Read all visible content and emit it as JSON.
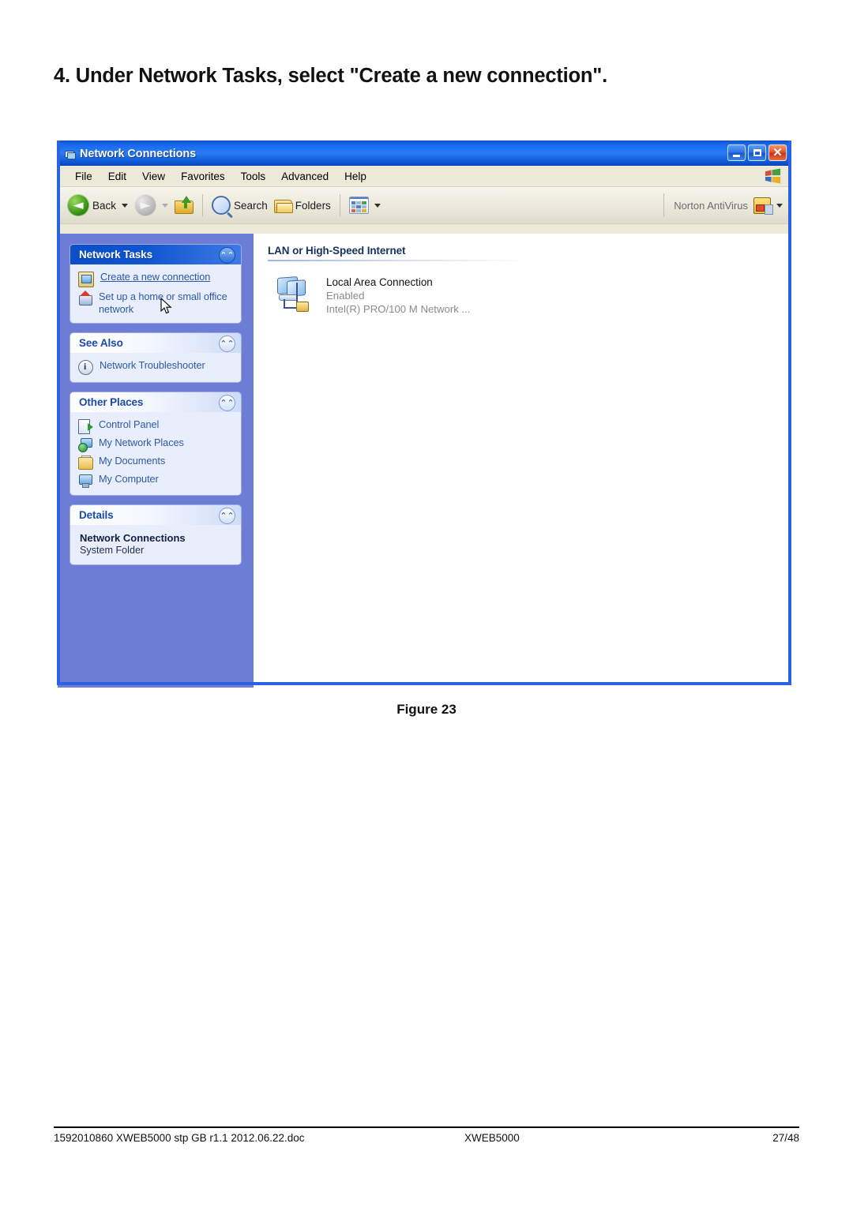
{
  "page": {
    "heading": "4. Under Network Tasks, select \"Create a new connection\".",
    "figure_caption": "Figure 23"
  },
  "window": {
    "title": "Network Connections",
    "title_icon": "network-connections-icon",
    "controls": {
      "minimize": "minimize-button",
      "maximize": "maximize-button",
      "close": "close-button"
    },
    "menu": [
      "File",
      "Edit",
      "View",
      "Favorites",
      "Tools",
      "Advanced",
      "Help"
    ],
    "toolbar": {
      "back_label": "Back",
      "forward_label": "",
      "search_label": "Search",
      "folders_label": "Folders",
      "views_label": "",
      "norton_label": "Norton AntiVirus"
    }
  },
  "sidebar": {
    "panels": [
      {
        "title": "Network Tasks",
        "style": "dark",
        "items": [
          {
            "label": "Create a new connection",
            "icon": "new-connection-icon",
            "link": true
          },
          {
            "label": "Set up a home or small office network",
            "icon": "home-network-icon",
            "link": false
          }
        ]
      },
      {
        "title": "See Also",
        "style": "light",
        "items": [
          {
            "label": "Network Troubleshooter",
            "icon": "info-icon",
            "link": false
          }
        ]
      },
      {
        "title": "Other Places",
        "style": "light",
        "items": [
          {
            "label": "Control Panel",
            "icon": "control-panel-icon",
            "link": false
          },
          {
            "label": "My Network Places",
            "icon": "my-network-places-icon",
            "link": false
          },
          {
            "label": "My Documents",
            "icon": "my-documents-icon",
            "link": false
          },
          {
            "label": "My Computer",
            "icon": "my-computer-icon",
            "link": false
          }
        ]
      }
    ],
    "details": {
      "title": "Details",
      "style": "light",
      "name": "Network Connections",
      "type": "System Folder"
    }
  },
  "content": {
    "group_header": "LAN or High-Speed Internet",
    "connections": [
      {
        "name": "Local Area Connection",
        "status": "Enabled",
        "device": "Intel(R) PRO/100 M Network ...",
        "icon": "lan-connection-icon"
      }
    ]
  },
  "footer": {
    "left": "1592010860 XWEB5000 stp GB r1.1 2012.06.22.doc",
    "center": "XWEB5000",
    "right": "27/48"
  },
  "colors": {
    "titlebar_blue": "#1763e6",
    "sidebar_blue": "#6d7dd6",
    "panel_header_dark": "#0a4ec8",
    "panel_body": "#e8eefc",
    "link_blue": "#2a56ad",
    "menubar_tan": "#ece9d8"
  }
}
